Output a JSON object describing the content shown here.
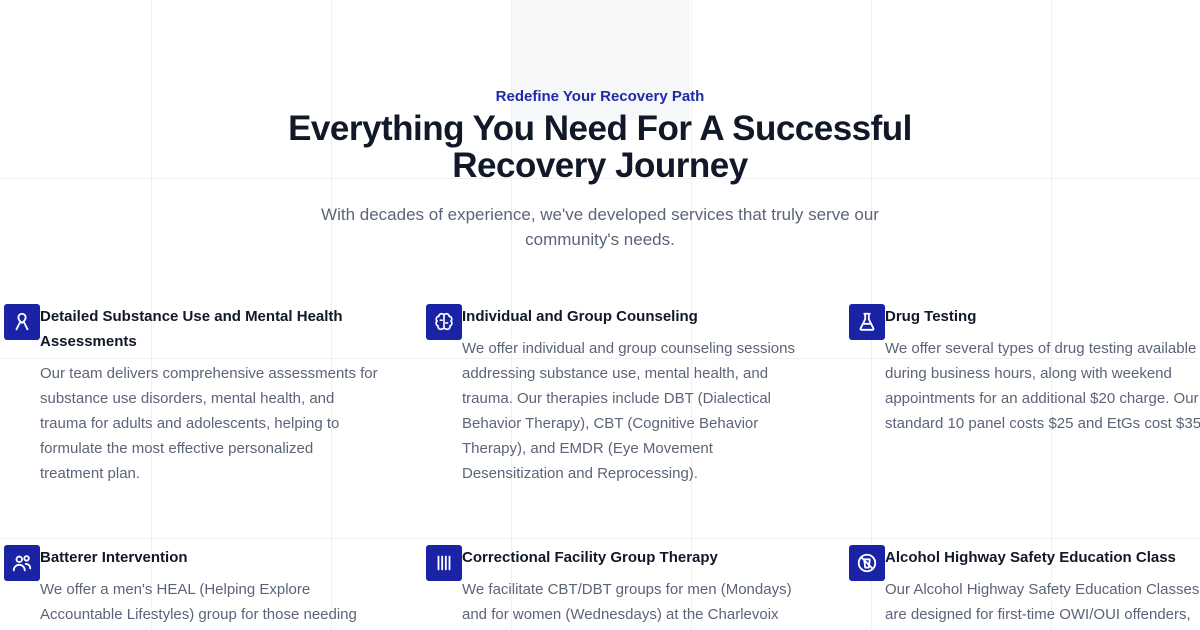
{
  "section": {
    "eyebrow": "Redefine Your Recovery Path",
    "title_line1": "Everything You Need For A Successful",
    "title_line2": "Recovery Journey",
    "subtitle": "With decades of experience, we've developed services that truly serve our community's needs."
  },
  "features": [
    {
      "icon": "ribbon-icon",
      "title": "Detailed Substance Use and Mental Health Assessments",
      "description": "Our team delivers comprehensive assessments for substance use disorders, mental health, and trauma for adults and adolescents, helping to formulate the most effective personalized treatment plan."
    },
    {
      "icon": "brain-icon",
      "title": "Individual and Group Counseling",
      "description": "We offer individual and group counseling sessions addressing substance use, mental health, and trauma. Our therapies include DBT (Dialectical Behavior Therapy), CBT (Cognitive Behavior Therapy), and EMDR (Eye Movement Desensitization and Reprocessing)."
    },
    {
      "icon": "flask-icon",
      "title": "Drug Testing",
      "description": "We offer several types of drug testing available during business hours, along with weekend appointments for an additional $20 charge. Our standard 10 panel costs $25 and EtGs cost $35"
    },
    {
      "icon": "users-icon",
      "title": "Batterer Intervention",
      "description": "We offer a men's HEAL (Helping Explore Accountable Lifestyles) group for those needing"
    },
    {
      "icon": "bars-icon",
      "title": "Correctional Facility Group Therapy",
      "description": "We facilitate CBT/DBT groups for men (Mondays) and for women (Wednesdays) at the Charlevoix"
    },
    {
      "icon": "no-drink-icon",
      "title": "Alcohol Highway Safety Education Class",
      "description": "Our Alcohol Highway Safety Education Classes are designed for first-time OWI/OUI offenders,"
    }
  ],
  "colors": {
    "accent": "#1a22a6",
    "eyebrow": "#1e2aa8",
    "heading": "#111827",
    "body_text": "#5b6478"
  }
}
